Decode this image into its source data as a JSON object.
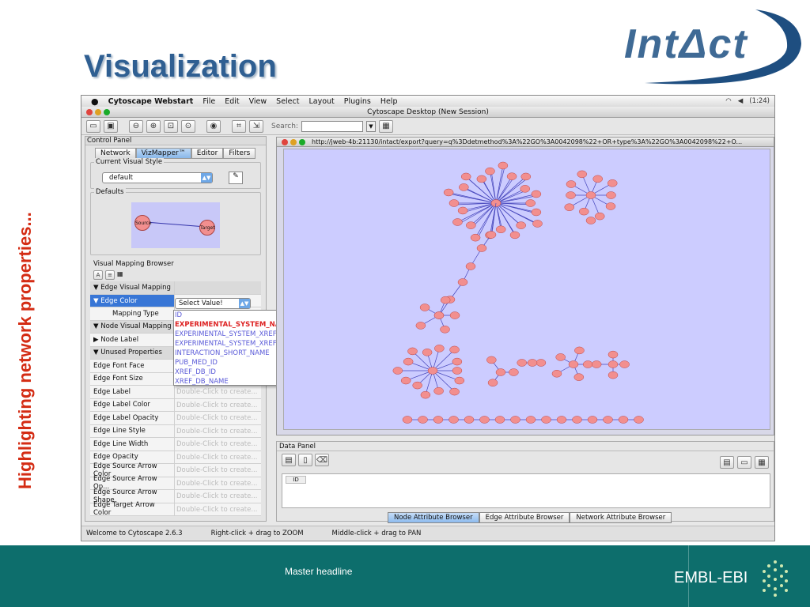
{
  "slide": {
    "title": "Visualization",
    "side_text": "Highlighting network properties...",
    "logo_text": "IntΔct",
    "footer_center": "Master headline",
    "footer_brand": "EMBL-EBI",
    "footer_color": "#0d6e6c"
  },
  "app": {
    "menu": [
      "Cytoscape Webstart",
      "File",
      "Edit",
      "View",
      "Select",
      "Layout",
      "Plugins",
      "Help"
    ],
    "status_time": "(1:24)",
    "window_title": "Cytoscape Desktop (New Session)",
    "search_label": "Search:",
    "control_panel_title": "Control Panel",
    "tabs": [
      "Network",
      "VizMapper™",
      "Editor",
      "Filters"
    ],
    "current_visual_style_label": "Current Visual Style",
    "visual_style_value": "default",
    "defaults_label": "Defaults",
    "default_source": "Source",
    "default_target": "Target",
    "visual_mapping_browser_label": "Visual Mapping Browser",
    "mapping_rows": [
      {
        "k": "▼ Edge Visual Mapping",
        "v": "",
        "type": "section"
      },
      {
        "k": "▼ Edge Color",
        "v": "",
        "type": "sel"
      },
      {
        "k": "Mapping Type",
        "v": "",
        "type": "indent"
      },
      {
        "k": "▼ Node Visual Mapping",
        "v": "",
        "type": "section"
      },
      {
        "k": "▶ Node Label",
        "v": "",
        "type": "row"
      },
      {
        "k": "▼ Unused Properties",
        "v": "",
        "type": "section"
      },
      {
        "k": "Edge Font Face",
        "v": "",
        "type": "row"
      },
      {
        "k": "Edge Font Size",
        "v": "",
        "type": "row"
      },
      {
        "k": "Edge Label",
        "v": "Double-Click to create...",
        "type": "row"
      },
      {
        "k": "Edge Label Color",
        "v": "Double-Click to create...",
        "type": "row"
      },
      {
        "k": "Edge Label Opacity",
        "v": "Double-Click to create...",
        "type": "row"
      },
      {
        "k": "Edge Line Style",
        "v": "Double-Click to create...",
        "type": "row"
      },
      {
        "k": "Edge Line Width",
        "v": "Double-Click to create...",
        "type": "row"
      },
      {
        "k": "Edge Opacity",
        "v": "Double-Click to create...",
        "type": "row"
      },
      {
        "k": "Edge Source Arrow Color",
        "v": "Double-Click to create...",
        "type": "row"
      },
      {
        "k": "Edge Source Arrow Op...",
        "v": "Double-Click to create...",
        "type": "row"
      },
      {
        "k": "Edge Source Arrow Shape",
        "v": "Double-Click to create...",
        "type": "row"
      },
      {
        "k": "Edge Target Arrow Color",
        "v": "Double-Click to create...",
        "type": "row"
      }
    ],
    "select_value": "Select Value!",
    "dropdown_items": [
      {
        "label": "ID",
        "hl": false
      },
      {
        "label": "EXPERIMENTAL_SYSTEM_NAME",
        "hl": true
      },
      {
        "label": "EXPERIMENTAL_SYSTEM_XREF_DB",
        "hl": false
      },
      {
        "label": "EXPERIMENTAL_SYSTEM_XREF_ID",
        "hl": false
      },
      {
        "label": "INTERACTION_SHORT_NAME",
        "hl": false
      },
      {
        "label": "PUB_MED_ID",
        "hl": false
      },
      {
        "label": "XREF_DB_ID",
        "hl": false
      },
      {
        "label": "XREF_DB_NAME",
        "hl": false
      }
    ],
    "network_url": "http://jweb-4b:21130/intact/export?query=q%3Ddetmethod%3A%22GO%3A0042098%22+OR+type%3A%22GO%3A0042098%22+O...",
    "data_panel_title": "Data Panel",
    "data_column": "ID",
    "data_tabs": [
      "Node Attribute Browser",
      "Edge Attribute Browser",
      "Network Attribute Browser"
    ],
    "status": [
      "Welcome to Cytoscape 2.6.3",
      "Right-click + drag  to  ZOOM",
      "Middle-click + drag  to  PAN"
    ],
    "node_color": "#f28f8f",
    "edge_color": "#4444bb",
    "canvas_color": "#ccccff"
  }
}
